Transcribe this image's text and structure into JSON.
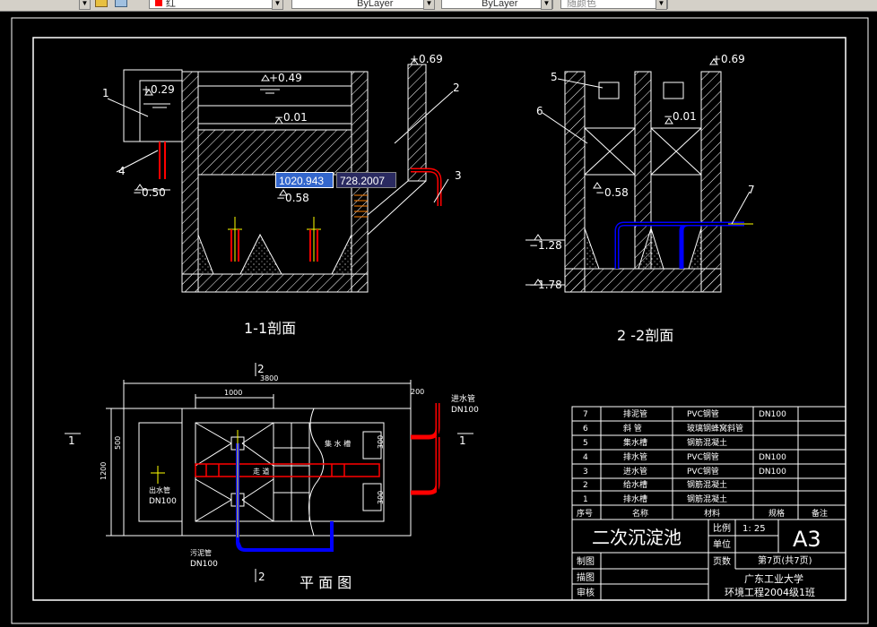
{
  "toolbar": {
    "color_value": "红",
    "linetype_value": "ByLayer",
    "lineweight_value": "ByLayer",
    "plotstyle_value": "随颜色"
  },
  "coordinate_input": {
    "x": "1020.943",
    "y": "728.2007"
  },
  "section_1": {
    "title": "1-1剖面",
    "elev_top": "+0.49",
    "elev_left": "+0.29",
    "elev_right": "+0.69",
    "elev_mid": "−0.01",
    "elev_low_left": "−0.50",
    "elev_low_mid": "−0.58",
    "callouts": [
      "1",
      "2",
      "3",
      "4"
    ]
  },
  "section_2": {
    "title": "2 -2剖面",
    "elev_top": "+0.69",
    "elev_mid": "−0.01",
    "elev_a": "−0.58",
    "elev_b": "−1.28",
    "elev_c": "−1.78",
    "callouts": [
      "5",
      "6",
      "7"
    ]
  },
  "plan": {
    "title": "平 面 图",
    "dim_total": "3800",
    "dim_part": "1000",
    "dim_small": "200",
    "dim_height": "1200",
    "dim_500": "500",
    "dim_right_a": "300",
    "dim_right_b": "300",
    "section_mark_2": "2",
    "section_mark_1": "1",
    "label_inlet_pipe": "进水管",
    "label_inlet_dn": "DN100",
    "label_outlet_pipe": "出水管",
    "label_outlet_dn": "DN100",
    "label_sludge_pipe": "污泥管",
    "label_sludge_dn": "DN100",
    "label_collect": "集 水 槽",
    "label_channel": "走 道"
  },
  "bom": {
    "header": {
      "no": "序号",
      "name": "名称",
      "material": "材料",
      "spec": "规格",
      "note": "备注"
    },
    "rows": [
      {
        "no": "7",
        "name": "排泥管",
        "material": "PVC钢管",
        "spec": "DN100"
      },
      {
        "no": "6",
        "name": "斜 管",
        "material": "玻璃钢蜂窝斜管",
        "spec": ""
      },
      {
        "no": "5",
        "name": "集水槽",
        "material": "钢筋混凝土",
        "spec": ""
      },
      {
        "no": "4",
        "name": "排水管",
        "material": "PVC钢管",
        "spec": "DN100"
      },
      {
        "no": "3",
        "name": "进水管",
        "material": "PVC钢管",
        "spec": "DN100"
      },
      {
        "no": "2",
        "name": "给水槽",
        "material": "钢筋混凝土",
        "spec": ""
      },
      {
        "no": "1",
        "name": "排水槽",
        "material": "钢筋混凝土",
        "spec": ""
      }
    ]
  },
  "title_block": {
    "drawing_name": "二次沉淀池",
    "scale_label": "比例",
    "scale_value": "1: 25",
    "size": "A3",
    "unit_label": "单位",
    "pages_label": "页数",
    "pages_value": "第7页(共7页)",
    "made_by": "制图",
    "drawn_by": "描图",
    "checked_by": "审核",
    "school": "广东工业大学",
    "class": "环境工程2004级1班"
  },
  "colors": {
    "background": "#000000",
    "lines": "#ffffff",
    "pipe_red": "#ff0000",
    "pipe_blue": "#0000ff",
    "pipe_yellow": "#ffff00",
    "coord_highlight": "#3366cc"
  },
  "icons": [
    "layer-icon",
    "layers-stack-icon",
    "color-swatch-icon",
    "dropdown-arrow-icon"
  ]
}
